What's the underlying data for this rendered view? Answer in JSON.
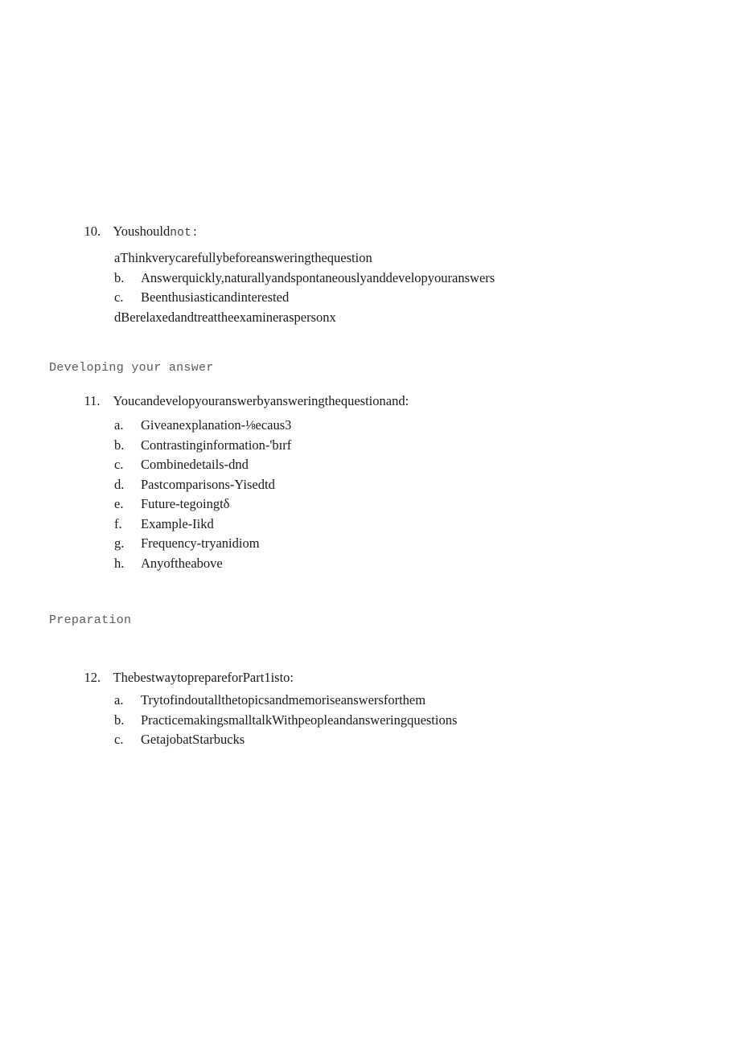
{
  "document": {
    "background_color": "#ffffff",
    "body_text_color": "#1a1a1a",
    "heading_text_color": "#5a5a5a"
  },
  "questions": [
    {
      "number": "10.",
      "stem_serif": "Youshould",
      "stem_mono": "not:",
      "options": [
        {
          "marker": "a",
          "tight": true,
          "text": "Thinkverycarefullybeforeansweringthequestion"
        },
        {
          "marker": "b.",
          "tight": false,
          "text": "Answerquickly,naturallyandspontaneouslyanddevelopyouranswers"
        },
        {
          "marker": "c.",
          "tight": false,
          "text": "Beenthusiasticandinterested"
        },
        {
          "marker": "d",
          "tight": true,
          "text": "Berelaxedandtreattheexamineraspersonx"
        }
      ]
    },
    {
      "number": "11.",
      "stem_serif": "Youcandevelopyouranswerbyansweringthequestionand:",
      "options": [
        {
          "marker": "a.",
          "tight": false,
          "text": "Giveanexplanation-⅛ecaus3"
        },
        {
          "marker": "b.",
          "tight": false,
          "text": "Contrastinginformation-'bɪrf"
        },
        {
          "marker": "c.",
          "tight": false,
          "text": "Combinedetails-dnd"
        },
        {
          "marker": "d.",
          "tight": false,
          "text": "Pastcomparisons-Yisedtd"
        },
        {
          "marker": "e.",
          "tight": false,
          "text": "Future-tegoingtδ"
        },
        {
          "marker": "f.",
          "tight": false,
          "text": "Example-Iikd"
        },
        {
          "marker": "g.",
          "tight": false,
          "text": "Frequency-tryanidiom"
        },
        {
          "marker": "h.",
          "tight": false,
          "text": "Anyoftheabove"
        }
      ]
    },
    {
      "number": "12.",
      "stem_serif": "ThebestwaytoprepareforPart1isto:",
      "options": [
        {
          "marker": "a.",
          "tight": false,
          "text": "Trytofindoutallthetopicsandmemoriseanswersforthem"
        },
        {
          "marker": "b.",
          "tight": false,
          "text": "PracticemakingsmalltalkWithpeopleandansweringquestions"
        },
        {
          "marker": "c.",
          "tight": false,
          "text": "GetajobatStarbucks"
        }
      ]
    }
  ],
  "headings": {
    "developing": "Developing your answer",
    "preparation": "Preparation"
  }
}
